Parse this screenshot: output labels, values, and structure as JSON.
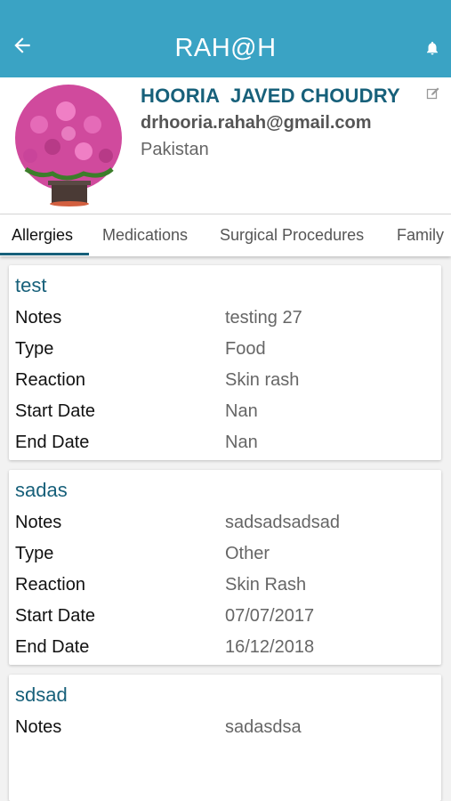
{
  "app": {
    "title": "RAH@H"
  },
  "profile": {
    "name": "HOORIA  JAVED CHOUDRY",
    "email": "drhooria.rahah@gmail.com",
    "country": "Pakistan"
  },
  "tabs": [
    {
      "label": "Allergies",
      "active": true
    },
    {
      "label": "Medications",
      "active": false
    },
    {
      "label": "Surgical Procedures",
      "active": false
    },
    {
      "label": "Family",
      "active": false
    }
  ],
  "cards": [
    {
      "title": "test",
      "rows": [
        {
          "label": "Notes",
          "value": "testing 27"
        },
        {
          "label": "Type",
          "value": "Food"
        },
        {
          "label": "Reaction",
          "value": "Skin rash"
        },
        {
          "label": "Start Date",
          "value": "Nan"
        },
        {
          "label": "End Date",
          "value": "Nan"
        }
      ]
    },
    {
      "title": "sadas",
      "rows": [
        {
          "label": "Notes",
          "value": "sadsadsadsad"
        },
        {
          "label": "Type",
          "value": "Other"
        },
        {
          "label": "Reaction",
          "value": "Skin Rash"
        },
        {
          "label": "Start Date",
          "value": "07/07/2017"
        },
        {
          "label": "End Date",
          "value": "16/12/2018"
        }
      ]
    },
    {
      "title": "sdsad",
      "rows": [
        {
          "label": "Notes",
          "value": "sadasdsa"
        }
      ]
    }
  ],
  "colors": {
    "appbar": "#3aa3c4",
    "accent": "#17607a"
  },
  "icons": {
    "back": "arrow-left-icon",
    "notifications": "bell-icon",
    "edit": "edit-icon"
  }
}
